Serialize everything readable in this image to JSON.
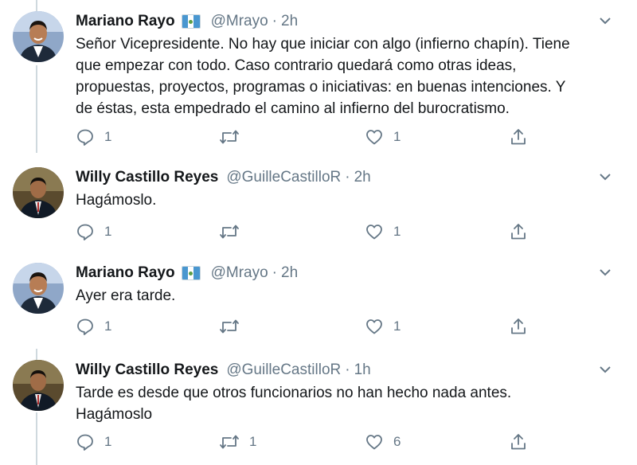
{
  "tweets": [
    {
      "name": "Mariano Rayo",
      "has_flag": true,
      "handle": "@Mrayo",
      "dot": "·",
      "time": "2h",
      "avatar": "avatar-mariano",
      "lines": [
        "Señor Vicepresidente. No hay que iniciar con algo (infierno chapín). Tiene",
        "que empezar con todo. Caso contrario quedará como otras ideas,",
        "propuestas, proyectos, programas o iniciativas: en buenas intenciones. Y",
        "de éstas, esta empedrado el camino al infierno del burocratismo."
      ],
      "replies": "1",
      "retweets": "",
      "likes": "1"
    },
    {
      "name": "Willy Castillo Reyes",
      "has_flag": false,
      "handle": "@GuilleCastilloR",
      "dot": "·",
      "time": "2h",
      "avatar": "avatar-willy",
      "lines": [
        "Hagámoslo."
      ],
      "replies": "1",
      "retweets": "",
      "likes": "1"
    },
    {
      "name": "Mariano Rayo",
      "has_flag": true,
      "handle": "@Mrayo",
      "dot": "·",
      "time": "2h",
      "avatar": "avatar-mariano",
      "lines": [
        "Ayer era tarde."
      ],
      "replies": "1",
      "retweets": "",
      "likes": "1"
    },
    {
      "name": "Willy Castillo Reyes",
      "has_flag": false,
      "handle": "@GuilleCastilloR",
      "dot": "·",
      "time": "1h",
      "avatar": "avatar-willy",
      "lines": [
        "Tarde es desde que otros funcionarios no han hecho nada antes.",
        "Hagámoslo"
      ],
      "replies": "1",
      "retweets": "1",
      "likes": "6"
    }
  ],
  "colors": {
    "text": "#14171a",
    "muted": "#657786",
    "thread_line": "#cfd9de",
    "flag_blue": "#4997d0"
  },
  "icons": [
    "reply-icon",
    "retweet-icon",
    "like-icon",
    "share-icon",
    "chevron-down-icon",
    "flag-guatemala-icon"
  ]
}
